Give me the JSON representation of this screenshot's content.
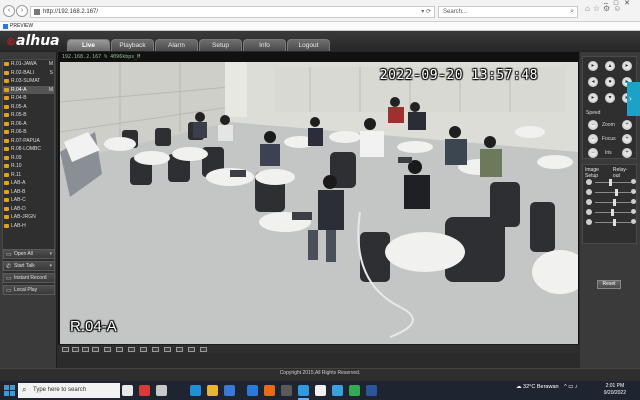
{
  "browser": {
    "url": "http://192.168.2.167/",
    "search_placeholder": "Search...",
    "tab_title": "PREVIEW"
  },
  "app": {
    "logo": "alhua",
    "tabs": [
      "Live",
      "Playback",
      "Alarm",
      "Setup",
      "Info",
      "Logout"
    ],
    "active_tab": "Live",
    "footer": "Copyright 2015,All Rights Reserved."
  },
  "cameras": [
    {
      "label": "R.01-JAWA",
      "flag": "M"
    },
    {
      "label": "R.02-BALI",
      "flag": "S"
    },
    {
      "label": "R.03-SUMAT",
      "flag": ""
    },
    {
      "label": "R.04-A",
      "flag": "M"
    },
    {
      "label": "R.04-B",
      "flag": ""
    },
    {
      "label": "R.05-A",
      "flag": ""
    },
    {
      "label": "R.05-B",
      "flag": ""
    },
    {
      "label": "R.06-A",
      "flag": ""
    },
    {
      "label": "R.06-B",
      "flag": ""
    },
    {
      "label": "R.07-PAPUA",
      "flag": ""
    },
    {
      "label": "R.08-LOMBC",
      "flag": ""
    },
    {
      "label": "R.09",
      "flag": ""
    },
    {
      "label": "R.10",
      "flag": ""
    },
    {
      "label": "R.11",
      "flag": ""
    },
    {
      "label": "LAB-A",
      "flag": ""
    },
    {
      "label": "LAB-B",
      "flag": ""
    },
    {
      "label": "LAB-C",
      "flag": ""
    },
    {
      "label": "LAB-D",
      "flag": ""
    },
    {
      "label": "LAB-JRGN",
      "flag": ""
    },
    {
      "label": "LAB-H",
      "flag": ""
    }
  ],
  "left_buttons": {
    "open_all": "Open All",
    "start_talk": "Start Talk",
    "instant_record": "Instant Record",
    "local_play": "Local Play"
  },
  "video": {
    "header": "192.168.2.167 % 4096kbps_M",
    "timestamp": "2022-09-20 13:57:48",
    "room_label": "R.04-A"
  },
  "ptz": {
    "zoom": "Zoom",
    "focus": "Focus",
    "iris": "Iris",
    "speed_label": "Speed"
  },
  "image_setup": {
    "title": "Image Setup",
    "relay_label": "Relay-out",
    "reset": "Reset",
    "slider_levels": [
      0.4,
      0.55,
      0.5,
      0.45,
      0.5
    ]
  },
  "taskbar": {
    "search_placeholder": "Type here to search",
    "weather": "32°C  Berawan",
    "time": "2:01 PM",
    "date": "9/20/2022"
  },
  "colors": {
    "accent_blue": "#1ea1c6",
    "logo_red": "#d31d1d",
    "camera_icon": "#e0a020"
  }
}
